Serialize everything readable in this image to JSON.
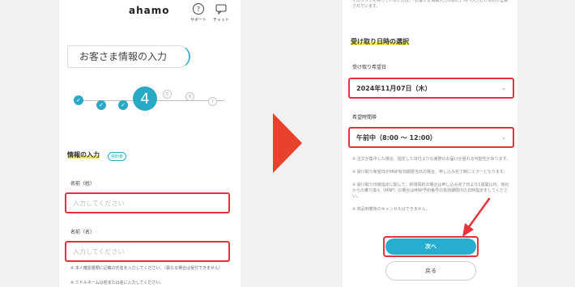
{
  "left": {
    "logo": "ahamo",
    "header": {
      "support_label": "サポート",
      "chat_label": "チャット"
    },
    "title": "お客さま情報の入力",
    "steps": {
      "done_mark": "✓",
      "current": "4",
      "future": [
        "5",
        "6",
        "?"
      ]
    },
    "section_title": "情報の入力",
    "section_chip": "契約者",
    "last_name_label": "名前（姓）",
    "last_name_placeholder": "入力してください",
    "first_name_label": "名前（名）",
    "first_name_placeholder": "入力してください",
    "note1": "※ 本人確認書類に記載の氏名を入力してください。（異なる場合は受付できません）",
    "note2": "※ ミドルネームは姓または名に入力してください。"
  },
  "right": {
    "top_note": "そのリンクを持っていない方は、「お客さま情報入力の前に」内へ入力したものが登録されています。",
    "section_title": "受け取り日時の選択",
    "date_label": "受け取り希望日",
    "date_value": "2024年11月07日（木）",
    "time_label": "希望時間帯",
    "time_value": "午前中（8:00 〜 12:00）",
    "notes": [
      "※ 注文が集中した場合、指定した日付よりも実際のお届けが遅れる可能性があります。",
      "※ 受け取り希望日がMNP有効期限当日の場合、申し込み完了時にエラーとなります。",
      "※ 受け取り日時指定に関して、新規契約の場合は申し込み完了日より1週間以内、他社からの乗り換え（MNP）の場合はMNP予約番号の有効期限内の日時指定をしてください。",
      "※ 商品到着後のキャンセルはできません。"
    ],
    "next_label": "次へ",
    "back_label": "戻る"
  },
  "colors": {
    "accent": "#26aed0",
    "highlight_box": "#e6323b",
    "arrow": "#e8412c",
    "marker": "#f3ec55"
  }
}
